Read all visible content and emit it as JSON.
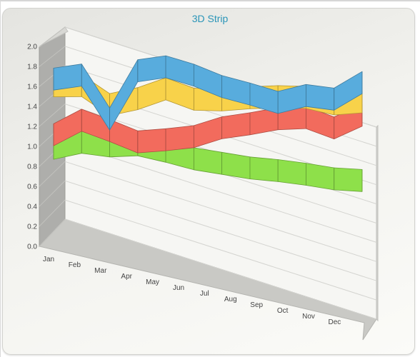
{
  "chart_data": {
    "type": "line",
    "variant": "3d-strip",
    "title": "3D Strip",
    "xlabel": "",
    "ylabel": "",
    "categories": [
      "Jan",
      "Feb",
      "Mar",
      "Apr",
      "May",
      "Jun",
      "Jul",
      "Aug",
      "Sep",
      "Oct",
      "Nov",
      "Dec"
    ],
    "ylim": [
      0,
      2.0
    ],
    "yticks": [
      "0.0",
      "0.2",
      "0.4",
      "0.6",
      "0.8",
      "1.0",
      "1.2",
      "1.4",
      "1.6",
      "1.8",
      "2.0"
    ],
    "grid": true,
    "legend": "none",
    "series": [
      {
        "color": "#8ee04a",
        "values": [
          0.83,
          0.91,
          0.89,
          0.92,
          0.87,
          0.81,
          0.78,
          0.75,
          0.74,
          0.72,
          0.69,
          0.69
        ]
      },
      {
        "color": "#f26b5d",
        "values": [
          0.97,
          1.14,
          1.05,
          0.95,
          0.99,
          1.04,
          1.15,
          1.21,
          1.28,
          1.31,
          1.22,
          1.37
        ]
      },
      {
        "color": "#f8d24a",
        "values": [
          1.48,
          1.5,
          1.32,
          1.4,
          1.52,
          1.43,
          1.44,
          1.48,
          1.51,
          1.52,
          1.47,
          1.51
        ]
      },
      {
        "color": "#58acdd",
        "values": [
          1.55,
          1.61,
          1.17,
          1.69,
          1.75,
          1.68,
          1.58,
          1.52,
          1.45,
          1.54,
          1.52,
          1.71
        ]
      }
    ]
  }
}
